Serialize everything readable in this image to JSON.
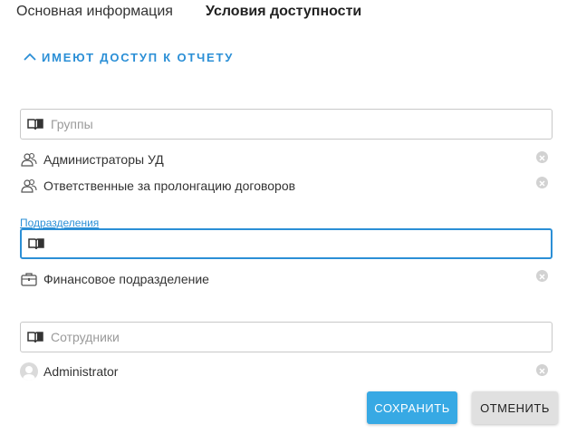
{
  "tabs": [
    {
      "label": "Основная информация",
      "active": false
    },
    {
      "label": "Условия доступности",
      "active": true
    }
  ],
  "section": {
    "title": "ИМЕЮТ ДОСТУП К ОТЧЕТУ",
    "expanded": true
  },
  "groups": {
    "placeholder": "Группы",
    "items": [
      "Администраторы УД",
      "Ответственные за пролонгацию договоров"
    ]
  },
  "departments": {
    "label": "Подразделения",
    "value": "",
    "items": [
      "Финансовое подразделение"
    ]
  },
  "employees": {
    "placeholder": "Сотрудники",
    "items": [
      "Administrator"
    ]
  },
  "buttons": {
    "save": "СОХРАНИТЬ",
    "cancel": "ОТМЕНИТЬ"
  },
  "icons": {
    "section_toggle": "chevron-up-icon",
    "field": "book-icon",
    "group_item": "user-group-icon",
    "department_item": "briefcase-icon",
    "employee_item": "avatar-icon",
    "remove": "close-circle-icon"
  },
  "colors": {
    "accent": "#2b8fd6",
    "save_button": "#37a9e4",
    "cancel_button": "#e0e0e0"
  }
}
